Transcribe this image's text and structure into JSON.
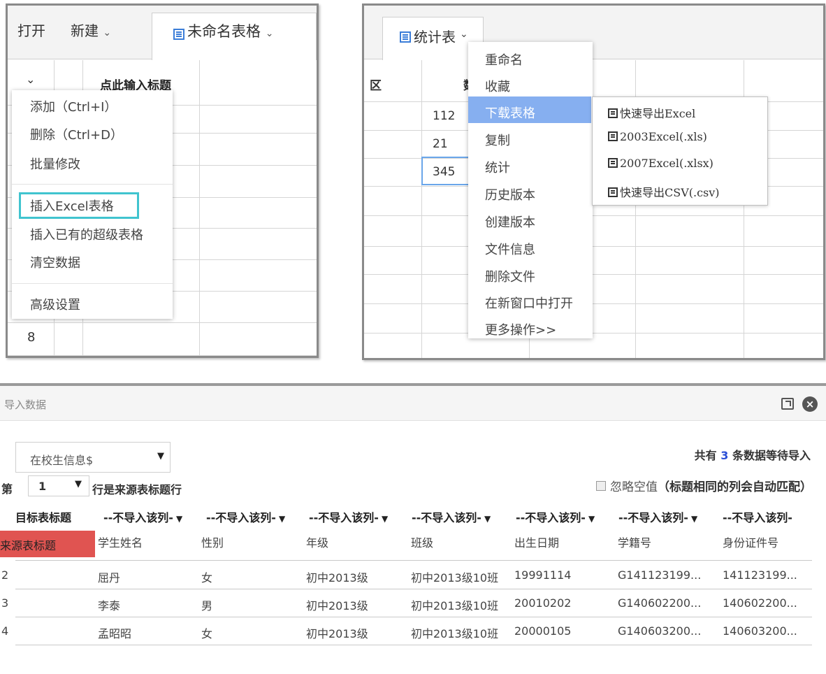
{
  "panel1": {
    "toolbar": {
      "open": "打开",
      "new": "新建",
      "doc_title": "未命名表格"
    },
    "grid": {
      "header_title": "点此输入标题",
      "row_number": "8"
    },
    "context_menu": {
      "items": [
        "添加（Ctrl+I）",
        "删除（Ctrl+D）",
        "批量修改",
        "插入Excel表格",
        "插入已有的超级表格",
        "清空数据",
        "高级设置"
      ],
      "highlighted": "插入Excel表格",
      "highlight_color": "#40c4cf"
    }
  },
  "panel2": {
    "tab_title": "统计表",
    "grid": {
      "col_partial_a": "区",
      "col_partial_b": "数",
      "values": [
        "112",
        "21",
        "345"
      ]
    },
    "context_menu": {
      "items": [
        "重命名",
        "收藏",
        "下载表格",
        "复制",
        "统计",
        "历史版本",
        "创建版本",
        "文件信息",
        "删除文件",
        "在新窗口中打开",
        "更多操作>>"
      ],
      "active": "下载表格",
      "active_color": "#86aff0"
    },
    "submenu": [
      "快速导出Excel",
      "2003Excel(.xls)",
      "2007Excel(.xlsx)",
      "快速导出CSV(.csv)"
    ]
  },
  "dialog": {
    "title": "导入数据",
    "sheet_select": "在校生信息$",
    "pending": {
      "prefix": "共有",
      "count": "3",
      "suffix": "条数据等待导入"
    },
    "row_prefix": "第",
    "row_value": "1",
    "row_suffix": "行是来源表标题行",
    "ignore_empty": {
      "label": "忽略空值",
      "note": "（标题相同的列会自动匹配）"
    },
    "table": {
      "target_label": "目标表标题",
      "column_select": "--不导入该列-",
      "source_label": "来源表标题",
      "source_color": "#e05451",
      "source_headers": [
        "学生姓名",
        "性别",
        "年级",
        "班级",
        "出生日期",
        "学籍号",
        "身份证件号"
      ],
      "rows": [
        [
          "2",
          "屈丹",
          "女",
          "初中2013级",
          "初中2013级10班",
          "19991114",
          "G141123199...",
          "141123199..."
        ],
        [
          "3",
          "李泰",
          "男",
          "初中2013级",
          "初中2013级10班",
          "20010202",
          "G140602200...",
          "140602200..."
        ],
        [
          "4",
          "孟昭昭",
          "女",
          "初中2013级",
          "初中2013级10班",
          "20000105",
          "G140603200...",
          "140603200..."
        ]
      ]
    }
  }
}
